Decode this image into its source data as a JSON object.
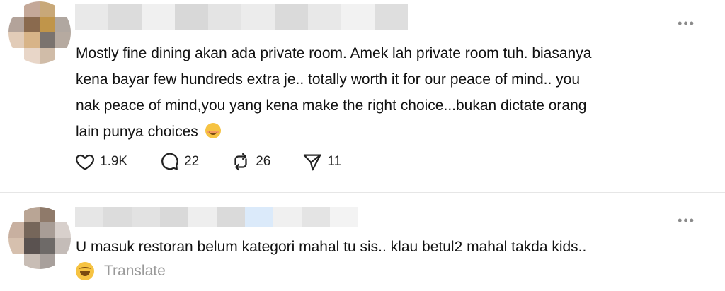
{
  "posts": [
    {
      "username_colors": [
        "#e9e9e9",
        "#dcdcdc",
        "#f0f0f0",
        "#d8d8d8",
        "#e4e4e4",
        "#ececec",
        "#dadada",
        "#e8e8e8",
        "#f2f2f2",
        "#dedede"
      ],
      "avatar_colors": [
        "#ffffff",
        "#c4a898",
        "#c8a878",
        "#ffffff",
        "#b3a39a",
        "#8a6a4e",
        "#c0954a",
        "#b0a7a0",
        "#e2ccb8",
        "#d8b488",
        "#7a736e",
        "#b6aaa0",
        "#ffffff",
        "#e8d6c8",
        "#d0bca8",
        "#ffffff"
      ],
      "text": "Mostly fine dining akan ada private room. Amek lah private room tuh. biasanya\nkena bayar few hundreds extra je.. totally worth it for our peace of mind.. you\nnak peace of mind,you yang kena make the right choice...bukan dictate orang\nlain punya choices",
      "emoji_icon": "smiling-face-icon",
      "more_label": "•••",
      "actions": {
        "likes": "1.9K",
        "replies": "22",
        "reposts": "26",
        "shares": "11"
      }
    },
    {
      "username_colors": [
        "#e6e6e6",
        "#dcdcdc",
        "#e2e2e2",
        "#d9d9d9",
        "#eeeeee",
        "#dadada",
        "#dbeafa",
        "#f0f0f0",
        "#e4e4e4",
        "#f3f3f3"
      ],
      "avatar_colors": [
        "#ffffff",
        "#b9a595",
        "#8f7a6a",
        "#ffffff",
        "#c8b0a0",
        "#76665a",
        "#a89d96",
        "#d8d0cc",
        "#d6c0ae",
        "#5a5250",
        "#6e6a68",
        "#c4bcb8",
        "#ffffff",
        "#c8bdb5",
        "#a8a09c",
        "#ffffff"
      ],
      "text": "U masuk restoran belum kategori mahal tu sis.. klau betul2 mahal takda kids..",
      "more_label": "•••",
      "translate_emoji_icon": "rolling-laughing-face-icon",
      "translate_label": "Translate"
    }
  ]
}
